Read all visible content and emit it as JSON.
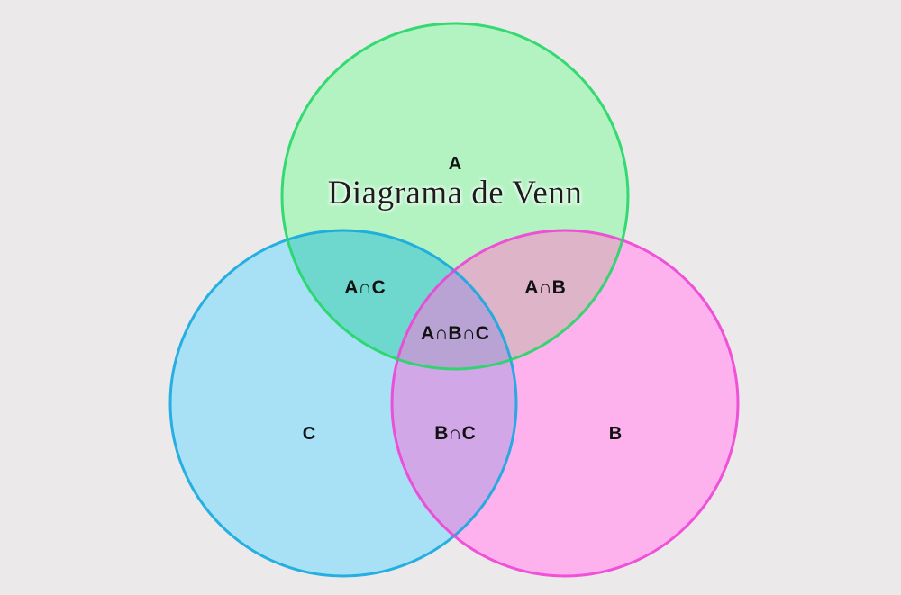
{
  "title": "Diagrama de Venn",
  "colors": {
    "background": "#ebe9ea",
    "set_a_fill": "#b3f2c1",
    "set_a_stroke": "#22d766",
    "set_b_fill": "#fdb2ee",
    "set_b_stroke": "#f043d6",
    "set_c_fill": "#a8e1f5",
    "set_c_stroke": "#14a9df",
    "region_a_and_c": "#6ed8ce",
    "region_a_and_b": "#ddb4c8",
    "region_b_and_c": "#d2a7e8",
    "region_a_and_b_and_c": "#b8a3d4",
    "title_shadow": "#ffffff"
  },
  "sets": {
    "a": {
      "label": "A"
    },
    "b": {
      "label": "B"
    },
    "c": {
      "label": "C"
    }
  },
  "regions": {
    "a_and_c": "A∩C",
    "a_and_b": "A∩B",
    "b_and_c": "B∩C",
    "a_and_b_and_c": "A∩B∩C"
  }
}
